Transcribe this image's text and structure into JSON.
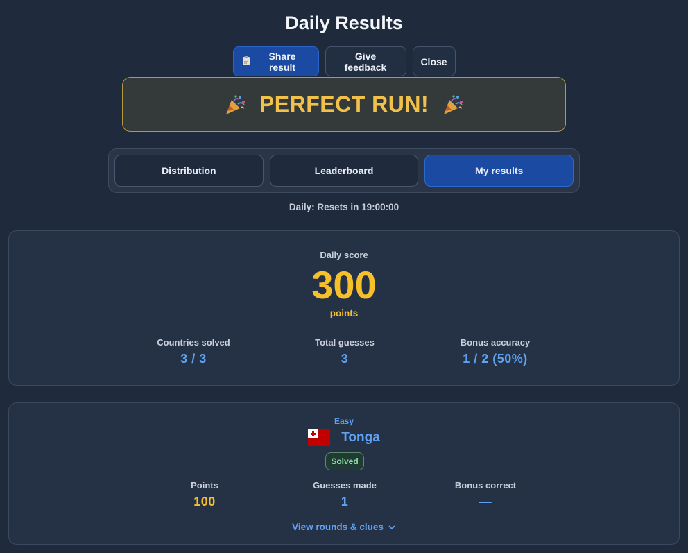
{
  "header": {
    "title": "Daily Results"
  },
  "actions": {
    "share_label": "Share result",
    "feedback_label": "Give feedback",
    "close_label": "Close"
  },
  "banner": {
    "text": "PERFECT RUN!"
  },
  "tabs": [
    {
      "label": "Distribution",
      "active": false
    },
    {
      "label": "Leaderboard",
      "active": false
    },
    {
      "label": "My results",
      "active": true
    }
  ],
  "reset_text": "Daily: Resets in 19:00:00",
  "score": {
    "label": "Daily score",
    "value": "300",
    "unit": "points",
    "stats": [
      {
        "label": "Countries solved",
        "value": "3 / 3"
      },
      {
        "label": "Total guesses",
        "value": "3"
      },
      {
        "label": "Bonus accuracy",
        "value": "1 / 2 (50%)"
      }
    ]
  },
  "country": {
    "difficulty": "Easy",
    "name": "Tonga",
    "status": "Solved",
    "stats": [
      {
        "label": "Points",
        "value": "100"
      },
      {
        "label": "Guesses made",
        "value": "1"
      },
      {
        "label": "Bonus correct",
        "value": "—"
      }
    ],
    "view_link": "View rounds & clues"
  },
  "colors": {
    "background": "#1f2a3c",
    "accent_blue": "#1b4aa3",
    "gold": "#f6c02b",
    "link_blue": "#5fa2f2",
    "success_green": "#8fe0a8"
  },
  "icons": {
    "share": "clipboard-icon",
    "celebrate": "party-popper-icon",
    "flag": "tonga-flag-icon",
    "expand": "chevron-down-icon"
  }
}
